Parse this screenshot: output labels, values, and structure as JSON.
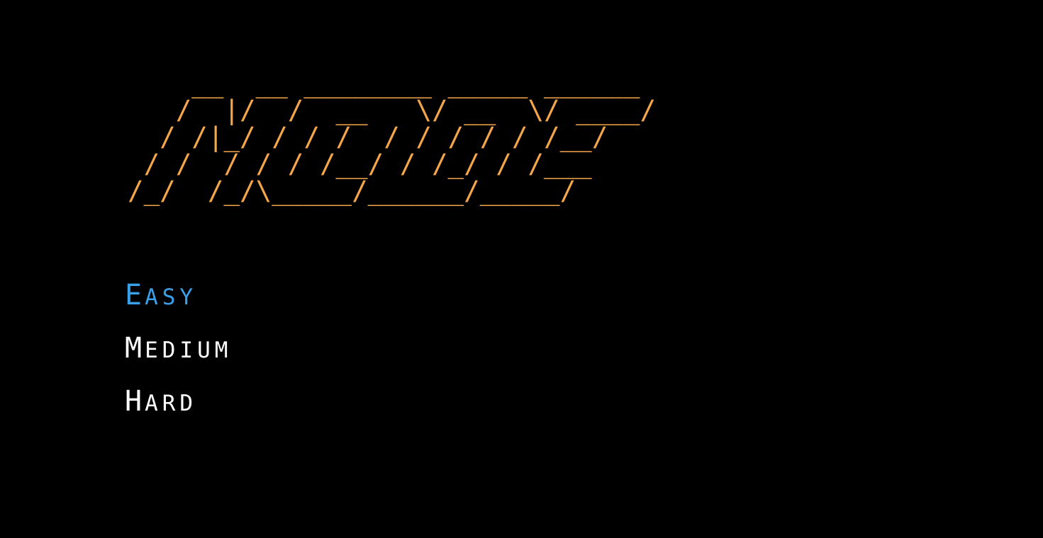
{
  "title": {
    "text": "MODE",
    "art_lines": [
      "    __  __ ________ _____ ______",
      "   /  |/  /  __   \\/ __  \\/ ____/",
      "  / /|_/ / / /  / / / / / /__/",
      " / /  / / / /__/ / /_/ / /___",
      "/_/  /_/\\_____/______/_____/"
    ],
    "color": "#f5a64a"
  },
  "menu": {
    "items": [
      {
        "initial": "E",
        "rest": "ASY",
        "label": "EASY",
        "selected": true
      },
      {
        "initial": "M",
        "rest": "EDIUM",
        "label": "MEDIUM",
        "selected": false
      },
      {
        "initial": "H",
        "rest": "ARD",
        "label": "HARD",
        "selected": false
      }
    ],
    "selected_color": "#3aa0ea",
    "default_color": "#ffffff"
  }
}
